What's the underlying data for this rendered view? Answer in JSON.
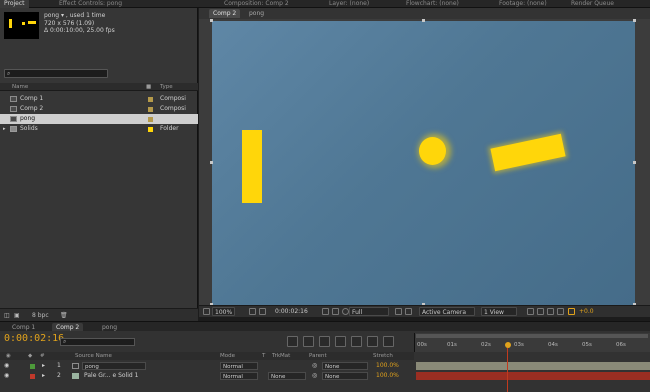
{
  "top_tabs": {
    "project": "Project",
    "effect_controls": "Effect Controls: pong",
    "composition": "Composition: Comp 2",
    "layer": "Layer: (none)",
    "flowchart": "Flowchart: (none)",
    "footage": "Footage: (none)",
    "render_queue": "Render Queue"
  },
  "project": {
    "item_name": "pong ▾ , used 1 time",
    "dimensions": "720 x 576 (1.09)",
    "duration": "Δ 0:00:10:00, 25.00 fps",
    "search_placeholder": "",
    "col_name": "Name",
    "col_type": "Type",
    "items": [
      {
        "name": "Comp 1",
        "type": "Composi"
      },
      {
        "name": "Comp 2",
        "type": "Composi"
      },
      {
        "name": "pong",
        "type": ""
      },
      {
        "name": "Solids",
        "type": "Folder"
      }
    ],
    "bpc": "8 bpc"
  },
  "composition": {
    "tab": "Comp 2",
    "breadcrumb": "pong"
  },
  "viewer": {
    "zoom": "100%",
    "timecode": "0:00:02:16",
    "resolution": "Full",
    "camera": "Active Camera",
    "views": "1 View",
    "exposure": "+0.0"
  },
  "timeline": {
    "tabs": [
      "Comp 1",
      "Comp 2",
      "pong"
    ],
    "current_time": "0:00:02:16",
    "columns": {
      "source_name": "Source Name",
      "mode": "Mode",
      "t": "T",
      "trkmat": "TrkMat",
      "parent": "Parent",
      "stretch": "Stretch"
    },
    "layers": [
      {
        "num": "1",
        "name": "pong",
        "mode": "Normal",
        "trkmat": "",
        "parent": "None",
        "stretch": "100.0%"
      },
      {
        "num": "2",
        "name": "Pale Gr... e Solid 1",
        "mode": "Normal",
        "trkmat": "None",
        "parent": "None",
        "stretch": "100.0%"
      }
    ],
    "ruler": [
      "00s",
      "01s",
      "02s",
      "03s",
      "04s",
      "05s",
      "06s"
    ],
    "colors": {
      "timecode": "#e0a21c",
      "layer1_label": "#4d9a3a",
      "layer2_label": "#c0392b"
    }
  }
}
